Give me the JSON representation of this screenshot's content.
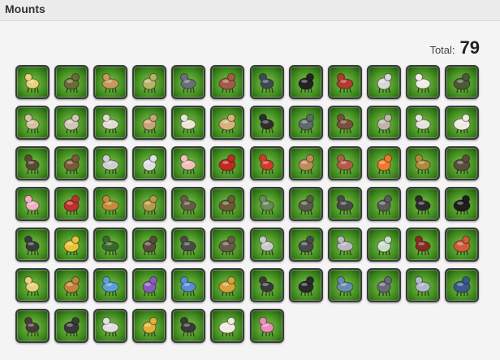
{
  "header": {
    "title": "Mounts"
  },
  "summary": {
    "total_label": "Total:",
    "total_value": "79"
  },
  "mounts": [
    {
      "name": "chocobo-mount-icon",
      "color": "#e8d27a"
    },
    {
      "name": "dark-knight-mount-icon",
      "color": "#6b6a3a"
    },
    {
      "name": "tan-bird-mount-icon",
      "color": "#c89a5a"
    },
    {
      "name": "toad-mount-icon",
      "color": "#b9b36a"
    },
    {
      "name": "dragon-mount-icon",
      "color": "#6a6e7a"
    },
    {
      "name": "red-dragon-mount-icon",
      "color": "#a85a4a"
    },
    {
      "name": "beast-mount-icon",
      "color": "#3d4a55"
    },
    {
      "name": "black-wolf-mount-icon",
      "color": "#232323"
    },
    {
      "name": "red-wyvern-mount-icon",
      "color": "#b23a2e"
    },
    {
      "name": "white-tiger-mount-icon",
      "color": "#d8d8d8"
    },
    {
      "name": "unicorn-mount-icon",
      "color": "#f0ece6"
    },
    {
      "name": "green-dragon-mount-icon",
      "color": "#4c5a3a"
    },
    {
      "name": "lion-mount-icon",
      "color": "#d6c2a2"
    },
    {
      "name": "elephant-mount-icon",
      "color": "#cfc6b4"
    },
    {
      "name": "white-beast-mount-icon",
      "color": "#e2ddd2"
    },
    {
      "name": "camel-mount-icon",
      "color": "#c9a37a"
    },
    {
      "name": "antelope-mount-icon",
      "color": "#ece6d6"
    },
    {
      "name": "horse-mount-icon",
      "color": "#d8b27a"
    },
    {
      "name": "black-bird-mount-icon",
      "color": "#2e2e2e"
    },
    {
      "name": "crocodile-mount-icon",
      "color": "#5e6a6a"
    },
    {
      "name": "boar-mount-icon",
      "color": "#7a4e3a"
    },
    {
      "name": "reindeer-mount-icon",
      "color": "#bfb6a8"
    },
    {
      "name": "cat-mount-icon",
      "color": "#e6e2dc"
    },
    {
      "name": "llama-mount-icon",
      "color": "#efeae2"
    },
    {
      "name": "spiked-beast-mount-icon",
      "color": "#5a4a32"
    },
    {
      "name": "insect-mount-icon",
      "color": "#7a5a3a"
    },
    {
      "name": "helmet-mount-icon",
      "color": "#cfcfcf"
    },
    {
      "name": "magpie-mount-icon",
      "color": "#e0e0e0"
    },
    {
      "name": "pig-mount-icon",
      "color": "#f0c0b8"
    },
    {
      "name": "red-cage-mount-icon",
      "color": "#c02a22"
    },
    {
      "name": "fire-bird-mount-icon",
      "color": "#d23a2a"
    },
    {
      "name": "lamp-mount-icon",
      "color": "#c08a5a"
    },
    {
      "name": "serpent-mount-icon",
      "color": "#b45a4a"
    },
    {
      "name": "orange-worm-mount-icon",
      "color": "#f07a2a"
    },
    {
      "name": "round-pod-mount-icon",
      "color": "#b08a3a"
    },
    {
      "name": "mech-mount-icon",
      "color": "#5a4e3e"
    },
    {
      "name": "pink-axolotl-mount-icon",
      "color": "#f2b0c2"
    },
    {
      "name": "red-pod-mount-icon",
      "color": "#c0302e"
    },
    {
      "name": "tiger-mount-icon",
      "color": "#c88a3a"
    },
    {
      "name": "gold-dragon-mount-icon",
      "color": "#b89a4a"
    },
    {
      "name": "spiky-beast-mount-icon",
      "color": "#6a5a4a"
    },
    {
      "name": "scorpion-mount-icon",
      "color": "#6a5a3a"
    },
    {
      "name": "big-frog-mount-icon",
      "color": "#6a8a5a"
    },
    {
      "name": "golem-mount-icon",
      "color": "#5a5a4a"
    },
    {
      "name": "walker-mount-icon",
      "color": "#4a4a4a"
    },
    {
      "name": "round-robot-mount-icon",
      "color": "#5a5a5a"
    },
    {
      "name": "motorcycle-mount-icon",
      "color": "#2a2a2a"
    },
    {
      "name": "black-bike-mount-icon",
      "color": "#1e1e1e"
    },
    {
      "name": "skeleton-wing-mount-icon",
      "color": "#3a3a3a"
    },
    {
      "name": "taxi-car-mount-icon",
      "color": "#e8c43a"
    },
    {
      "name": "green-cage-mount-icon",
      "color": "#3a6a2a"
    },
    {
      "name": "kaiju-mount-icon",
      "color": "#5a4a3a"
    },
    {
      "name": "manta-mount-icon",
      "color": "#4a4a4a"
    },
    {
      "name": "armored-mount-icon",
      "color": "#6a5a4a"
    },
    {
      "name": "robot-skull-mount-icon",
      "color": "#c8c8c8"
    },
    {
      "name": "mech-gun-mount-icon",
      "color": "#4a4a4a"
    },
    {
      "name": "silver-mech-mount-icon",
      "color": "#b8b8c0"
    },
    {
      "name": "saucer-mount-icon",
      "color": "#c8e0c8"
    },
    {
      "name": "red-chair-mount-icon",
      "color": "#8a2a22"
    },
    {
      "name": "red-seahorse-mount-icon",
      "color": "#d05a3a"
    },
    {
      "name": "yellow-unicorn-mount-icon",
      "color": "#e8d27a"
    },
    {
      "name": "brown-horse-mount-icon",
      "color": "#c0843a"
    },
    {
      "name": "blue-horse-mount-icon",
      "color": "#5aa0d8"
    },
    {
      "name": "purple-horse-mount-icon",
      "color": "#8a5ac0"
    },
    {
      "name": "blue-pegasus-mount-icon",
      "color": "#5a8ad8"
    },
    {
      "name": "gold-horse-mount-icon",
      "color": "#d8a23a"
    },
    {
      "name": "dark-wolf-mount-icon",
      "color": "#3a3a3a"
    },
    {
      "name": "gold-wolf-mount-icon",
      "color": "#2a2a2a"
    },
    {
      "name": "blue-wyvern-mount-icon",
      "color": "#6a8ab0"
    },
    {
      "name": "grey-dragon-mount-icon",
      "color": "#6a6a7a"
    },
    {
      "name": "silver-dragon-mount-icon",
      "color": "#b0b8c8"
    },
    {
      "name": "blue-dragon-mount-icon",
      "color": "#3a5a8a"
    },
    {
      "name": "bone-dragon-mount-icon",
      "color": "#4a3a3a"
    },
    {
      "name": "dark-lizard-mount-icon",
      "color": "#3a3a3a"
    },
    {
      "name": "white-wolf-mount-icon",
      "color": "#e0e0e0"
    },
    {
      "name": "golden-dragon-mount-icon",
      "color": "#e0b03a"
    },
    {
      "name": "black-dragon-mount-icon",
      "color": "#3a3a3a"
    },
    {
      "name": "scroll-mount-icon",
      "color": "#f0ece0"
    },
    {
      "name": "pink-egg-mount-icon",
      "color": "#f08ac0"
    }
  ]
}
